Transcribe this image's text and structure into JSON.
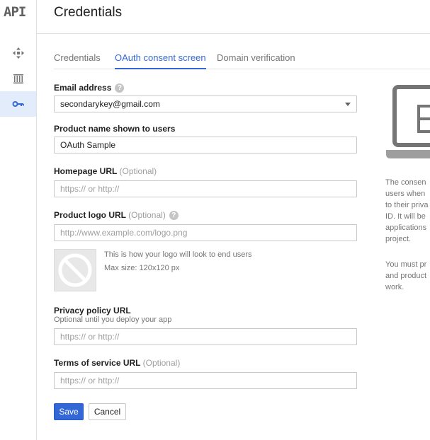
{
  "app": {
    "logo": "API"
  },
  "sidebar": {
    "items": [
      {
        "icon": "move-icon"
      },
      {
        "icon": "library-icon"
      },
      {
        "icon": "key-icon",
        "active": true
      }
    ]
  },
  "header": {
    "title": "Credentials"
  },
  "tabs": [
    {
      "label": "Credentials"
    },
    {
      "label": "OAuth consent screen",
      "active": true
    },
    {
      "label": "Domain verification"
    }
  ],
  "form": {
    "email": {
      "label": "Email address",
      "value": "secondarykey@gmail.com"
    },
    "product_name": {
      "label": "Product name shown to users",
      "value": "OAuth Sample"
    },
    "homepage": {
      "label": "Homepage URL",
      "optional": "(Optional)",
      "placeholder": "https:// or http://"
    },
    "product_logo": {
      "label": "Product logo URL",
      "optional": "(Optional)",
      "placeholder": "http://www.example.com/logo.png"
    },
    "logo_note": {
      "line1": "This is how your logo will look to end users",
      "line2": "Max size: 120x120 px"
    },
    "privacy": {
      "label": "Privacy policy URL",
      "sublabel": "Optional until you deploy your app",
      "placeholder": "https:// or http://"
    },
    "terms": {
      "label": "Terms of service URL",
      "optional": "(Optional)",
      "placeholder": "https:// or http://"
    }
  },
  "buttons": {
    "save": "Save",
    "cancel": "Cancel"
  },
  "info": {
    "lines1": [
      "The consen",
      "users when",
      "to their priva",
      "ID. It will be",
      "applications",
      "project."
    ],
    "lines2": [
      "You must pr",
      "and product",
      "work."
    ]
  },
  "colors": {
    "accent": "#3367d6",
    "active_bg": "#e3ecfa"
  }
}
